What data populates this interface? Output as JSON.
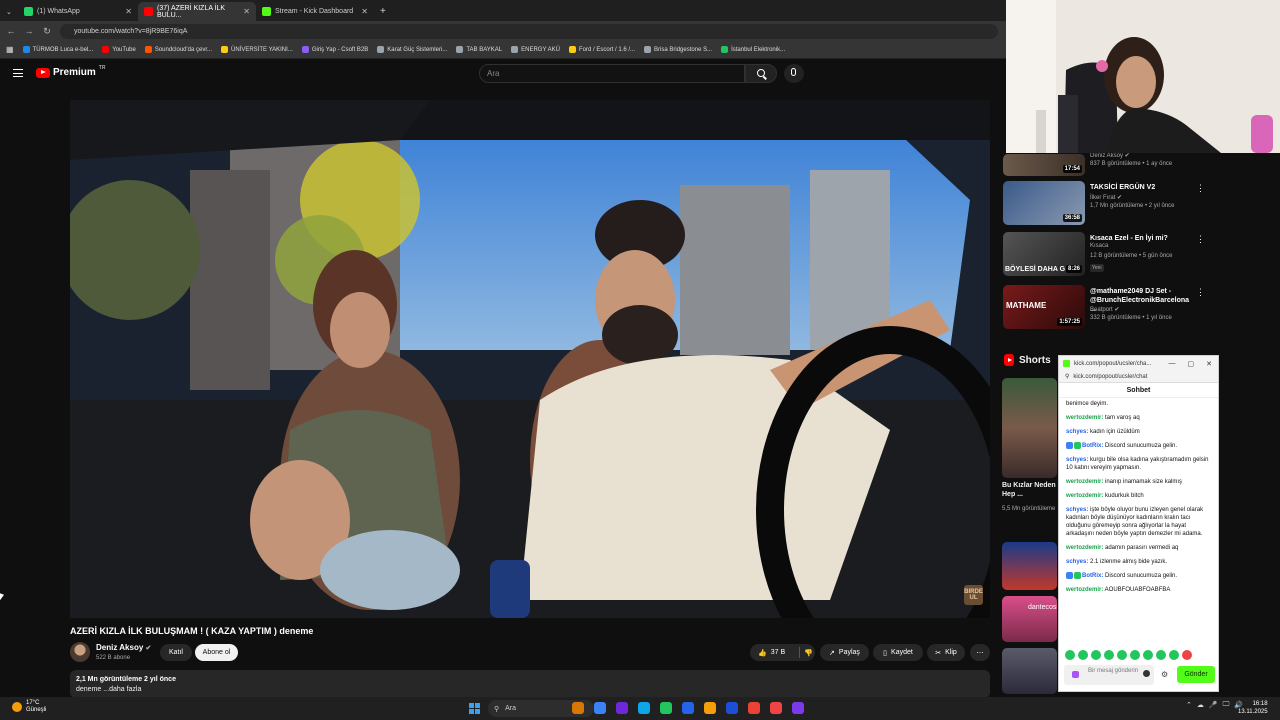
{
  "browser": {
    "tabs": [
      {
        "label": "(1) WhatsApp",
        "color": "#25d366"
      },
      {
        "label": "(37) AZERİ KIZLA İLK BULU...",
        "color": "#ff0000"
      },
      {
        "label": "Stream - Kick Dashboard",
        "color": "#53fc18"
      }
    ],
    "new_tab": "+",
    "url": "youtube.com/watch?v=8jR9BE76iqA",
    "bookmarks": [
      {
        "label": "TÜRMOB Luca e-bel...",
        "color": "#1e88e5"
      },
      {
        "label": "YouTube",
        "color": "#ff0000"
      },
      {
        "label": "Soundcloud'da çevr...",
        "color": "#ff5500"
      },
      {
        "label": "ÜNİVERSİTE YAKINI...",
        "color": "#facc15"
      },
      {
        "label": "Giriş Yap - Csoft B2B",
        "color": "#8b5cf6"
      },
      {
        "label": "Karat Güç Sistemleri...",
        "color": "#9ca3af"
      },
      {
        "label": "TAB BAYKAL",
        "color": "#9ca3af"
      },
      {
        "label": "ENERGY AKÜ",
        "color": "#9ca3af"
      },
      {
        "label": "Ford / Escort / 1.6 /...",
        "color": "#facc15"
      },
      {
        "label": "Brisa Bridgestone S...",
        "color": "#9ca3af"
      },
      {
        "label": "İstanbul Elektronik...",
        "color": "#22c55e"
      }
    ]
  },
  "youtube": {
    "logo": "Premium",
    "region": "TR",
    "search_placeholder": "Ara"
  },
  "video": {
    "watermark": "BIRDE UL",
    "title": "AZERİ KIZLA İLK BULUŞMAM ! ( KAZA YAPTIM ) deneme",
    "channel": "Deniz Aksoy",
    "subs": "522 B abone",
    "join": "Katıl",
    "subscribe": "Abone ol",
    "likes": "37 B",
    "share": "Paylaş",
    "save": "Kaydet",
    "clip": "Klip",
    "more": "⋯",
    "desc_stats": "2,1 Mn görüntüleme  2 yıl önce",
    "desc_text": "deneme ...daha fazla"
  },
  "sidebar": {
    "recs": [
      {
        "title": "",
        "channel": "Deniz Aksoy ✔",
        "meta": "837 B görüntüleme • 1 ay önce",
        "duration": "17:54"
      },
      {
        "title": "TAKSİCİ ERGÜN V2",
        "channel": "İlker Fırat ✔",
        "meta": "1,7 Mn görüntüleme • 2 yıl önce",
        "duration": "36:58"
      },
      {
        "title": "Kısaca Ezel - En İyi mi?",
        "channel": "Kısaca",
        "meta": "12 B görüntüleme • 5 gün önce",
        "duration": "8:26",
        "badge": "Yeni",
        "thumb_text": "BÖYLESİ DAHA G"
      },
      {
        "title": "@mathame2049 DJ Set - @BrunchElectronikBarcelona ...",
        "channel": "Beatport ✔",
        "meta": "332 B görüntüleme • 1 yıl önce",
        "duration": "1:57:25",
        "thumb_text": "MATHAME"
      }
    ],
    "shorts_label": "Shorts",
    "short1": {
      "title": "Bu Kızlar Neden Hep ...",
      "views": "5,5 Mn görüntüleme"
    },
    "short_logo": "dantecosi"
  },
  "kick": {
    "window_title": "kick.com/popout/ucsler/cha...",
    "url": "kick.com/popout/ucsler/chat",
    "minimize": "—",
    "maximize": "▢",
    "close": "✕",
    "chat_title": "Sohbet",
    "messages": [
      {
        "user": "",
        "text": "benimce deyim.",
        "color": "#111"
      },
      {
        "user": "wertozdemir:",
        "text": " tam varoş aq",
        "color": "#16a34a"
      },
      {
        "user": "schyes:",
        "text": " kadın için üzüldüm",
        "color": "#2563eb"
      },
      {
        "user": "BotRix:",
        "text": " Discord sunucumuza gelin.",
        "color": "#2563eb",
        "bot": true
      },
      {
        "user": "schyes:",
        "text": " kurgu bile olsa kadına yakıştıramadım gelsin 10 katını vereyim yapmasın.",
        "color": "#2563eb"
      },
      {
        "user": "wertozdemir:",
        "text": " inanıp inamamak size kalmış",
        "color": "#16a34a"
      },
      {
        "user": "wertozdemir:",
        "text": " kudurkuk bitch",
        "color": "#16a34a"
      },
      {
        "user": "schyes:",
        "text": " işte böyle oluyor bunu izleyen genel olarak kadınları böyle düşünüyor kadınların kralın tacı olduğunu göremeyip sonra ağlıyorlar la hayat arkadaşını neden böyle yaptın demezler mi adama.",
        "color": "#2563eb"
      },
      {
        "user": "wertozdemir:",
        "text": " adamın parasırı vermedi aq",
        "color": "#16a34a"
      },
      {
        "user": "schyes:",
        "text": " 2.1 izlenme almış bide yazık.",
        "color": "#2563eb"
      },
      {
        "user": "BotRix:",
        "text": " Discord sunucumuza gelin.",
        "color": "#2563eb",
        "bot": true
      },
      {
        "user": "wertozdemir:",
        "text": " AOUBFOUABFOABFBA",
        "color": "#16a34a"
      }
    ],
    "input_placeholder": "Bir mesaj gönderin",
    "send": "Gönder",
    "settings": "⚙"
  },
  "taskbar": {
    "temp": "17°C",
    "weather": "Güneşli",
    "search": "Ara",
    "time": "16:18",
    "date": "13.11.2025",
    "tray": [
      "⌃",
      "☁",
      "🎤",
      "🖵",
      "🔊"
    ],
    "apps": [
      "#d97706",
      "#3b82f6",
      "#6d28d9",
      "#0ea5e9",
      "#22c55e",
      "#2563eb",
      "#f59e0b",
      "#1d4ed8",
      "#ea4335",
      "#ef4444",
      "#7c3aed"
    ]
  }
}
